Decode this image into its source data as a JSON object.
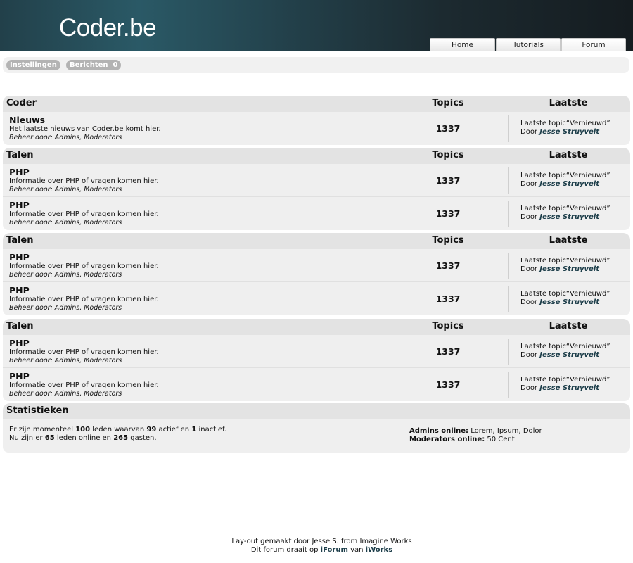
{
  "header": {
    "logo": "Coder.be",
    "nav": [
      "Home",
      "Tutorials",
      "Forum"
    ]
  },
  "userbar": {
    "settings_label": "Instellingen",
    "messages_label": "Berichten",
    "messages_count": "0"
  },
  "columns": {
    "topics": "Topics",
    "latest": "Laatste"
  },
  "categories": [
    {
      "title": "Coder",
      "forums": [
        {
          "name": "Nieuws",
          "description": "Het laatste nieuws van Coder.be komt hier.",
          "mods_prefix": "Beheer door:",
          "mods": "Admins, Moderators",
          "topics": "1337",
          "last_prefix": "Laatste topic",
          "last_topic": "“Vernieuwd”",
          "by_prefix": "Door",
          "by_user": "Jesse Struyvelt"
        }
      ]
    },
    {
      "title": "Talen",
      "forums": [
        {
          "name": "PHP",
          "description": "Informatie over PHP of vragen komen hier.",
          "mods_prefix": "Beheer door:",
          "mods": "Admins, Moderators",
          "topics": "1337",
          "last_prefix": "Laatste topic",
          "last_topic": "“Vernieuwd”",
          "by_prefix": "Door",
          "by_user": "Jesse Struyvelt"
        },
        {
          "name": "PHP",
          "description": "Informatie over PHP of vragen komen hier.",
          "mods_prefix": "Beheer door:",
          "mods": "Admins, Moderators",
          "topics": "1337",
          "last_prefix": "Laatste topic",
          "last_topic": "“Vernieuwd”",
          "by_prefix": "Door",
          "by_user": "Jesse Struyvelt"
        }
      ]
    },
    {
      "title": "Talen",
      "forums": [
        {
          "name": "PHP",
          "description": "Informatie over PHP of vragen komen hier.",
          "mods_prefix": "Beheer door:",
          "mods": "Admins, Moderators",
          "topics": "1337",
          "last_prefix": "Laatste topic",
          "last_topic": "“Vernieuwd”",
          "by_prefix": "Door",
          "by_user": "Jesse Struyvelt"
        },
        {
          "name": "PHP",
          "description": "Informatie over PHP of vragen komen hier.",
          "mods_prefix": "Beheer door:",
          "mods": "Admins, Moderators",
          "topics": "1337",
          "last_prefix": "Laatste topic",
          "last_topic": "“Vernieuwd”",
          "by_prefix": "Door",
          "by_user": "Jesse Struyvelt"
        }
      ]
    },
    {
      "title": "Talen",
      "forums": [
        {
          "name": "PHP",
          "description": "Informatie over PHP of vragen komen hier.",
          "mods_prefix": "Beheer door:",
          "mods": "Admins, Moderators",
          "topics": "1337",
          "last_prefix": "Laatste topic",
          "last_topic": "“Vernieuwd”",
          "by_prefix": "Door",
          "by_user": "Jesse Struyvelt"
        },
        {
          "name": "PHP",
          "description": "Informatie over PHP of vragen komen hier.",
          "mods_prefix": "Beheer door:",
          "mods": "Admins, Moderators",
          "topics": "1337",
          "last_prefix": "Laatste topic",
          "last_topic": "“Vernieuwd”",
          "by_prefix": "Door",
          "by_user": "Jesse Struyvelt"
        }
      ]
    }
  ],
  "stats": {
    "title": "Statistieken",
    "line1": {
      "a": "Er zijn momenteel",
      "members": "100",
      "b": "leden waarvan",
      "active": "99",
      "c": "actief en",
      "inactive": "1",
      "d": "inactief."
    },
    "line2": {
      "a": "Nu zijn er",
      "online_members": "65",
      "b": "leden online en",
      "guests": "265",
      "c": "gasten."
    },
    "admins_label": "Admins online:",
    "admins_value": "Lorem, Ipsum, Dolor",
    "mods_label": "Moderators online:",
    "mods_value": "50 Cent"
  },
  "footer": {
    "line1": "Lay-out gemaakt door Jesse S. from Imagine Works",
    "line2_a": "Dit forum draait op",
    "line2_b": "iForum",
    "line2_c": "van",
    "line2_d": "iWorks"
  }
}
